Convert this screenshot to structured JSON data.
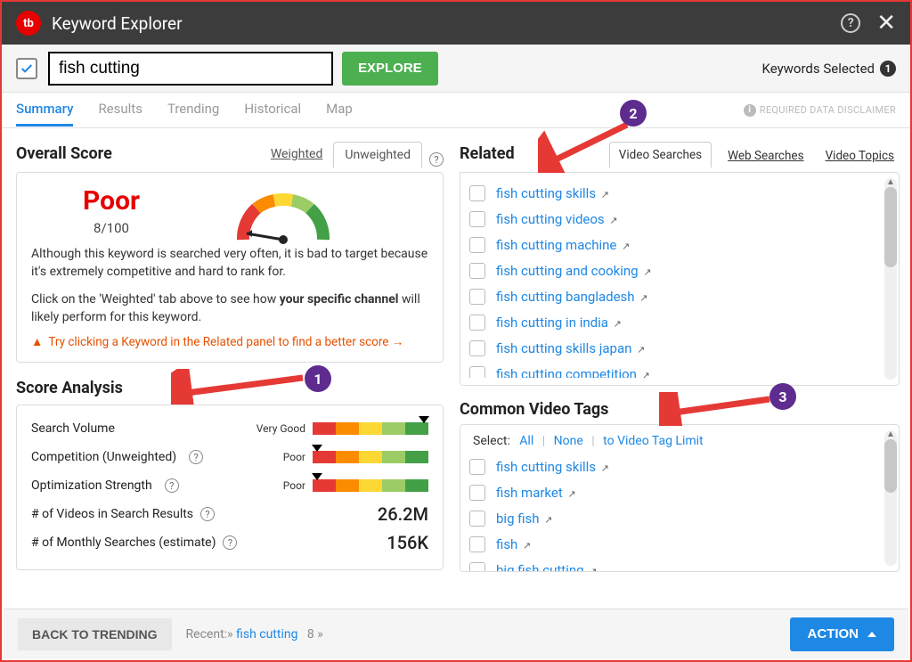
{
  "header": {
    "logo_text": "tb",
    "title": "Keyword Explorer"
  },
  "search": {
    "input_value": "fish cutting",
    "explore_label": "EXPLORE",
    "keywords_selected_label": "Keywords Selected",
    "keywords_selected_count": "1"
  },
  "nav_tabs": [
    "Summary",
    "Results",
    "Trending",
    "Historical",
    "Map"
  ],
  "nav_active": "Summary",
  "disclaimer": "REQUIRED DATA DISCLAIMER",
  "overall": {
    "section_title": "Overall Score",
    "tab_weighted": "Weighted",
    "tab_unweighted": "Unweighted",
    "rating_label": "Poor",
    "rating_score": "8/100",
    "text1": "Although this keyword is searched very often, it is bad to target because it's extremely competitive and hard to rank for.",
    "text2a": "Click on the 'Weighted' tab above to see how ",
    "text2b": "your specific channel",
    "text2c": " will likely perform for this keyword.",
    "hint": "Try clicking a Keyword in the Related panel to find a better score →"
  },
  "analysis": {
    "title": "Score Analysis",
    "metrics": [
      {
        "label": "Search Volume",
        "tag": "Very Good",
        "marker": 96,
        "has_q": false
      },
      {
        "label": "Competition (Unweighted)",
        "tag": "Poor",
        "marker": 4,
        "has_q": true
      },
      {
        "label": "Optimization Strength",
        "tag": "Poor",
        "marker": 4,
        "has_q": true
      }
    ],
    "stats": [
      {
        "label": "# of Videos in Search Results",
        "value": "26.2M",
        "has_q": true
      },
      {
        "label": "# of Monthly Searches (estimate)",
        "value": "156K",
        "has_q": true
      }
    ]
  },
  "related": {
    "title": "Related",
    "tabs": [
      "Video Searches",
      "Web Searches",
      "Video Topics"
    ],
    "active": "Video Searches",
    "items": [
      "fish cutting skills",
      "fish cutting videos",
      "fish cutting machine",
      "fish cutting and cooking",
      "fish cutting bangladesh",
      "fish cutting in india",
      "fish cutting skills japan",
      "fish cutting competition"
    ]
  },
  "tags": {
    "title": "Common Video Tags",
    "select_label": "Select:",
    "select_all": "All",
    "select_none": "None",
    "select_limit": "to Video Tag Limit",
    "items": [
      "fish cutting skills",
      "fish market",
      "big fish",
      "fish",
      "big fish cutting"
    ]
  },
  "footer": {
    "back_label": "BACK TO TRENDING",
    "recent_label": "Recent:»",
    "recent_link": "fish cutting",
    "recent_count": "8",
    "action_label": "ACTION"
  },
  "callouts": {
    "1": "1",
    "2": "2",
    "3": "3"
  }
}
